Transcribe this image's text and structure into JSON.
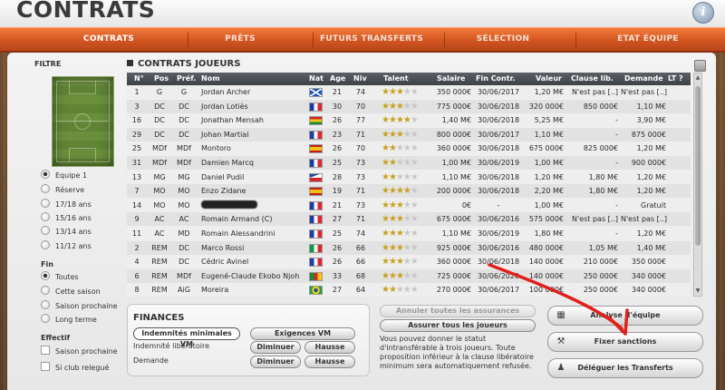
{
  "header": {
    "title": "CONTRATS",
    "info_icon": "info-icon"
  },
  "tabs": [
    {
      "label": "CONTRATS",
      "active": true
    },
    {
      "label": "PRÊTS",
      "active": false
    },
    {
      "label": "FUTURS TRANSFERTS",
      "active": false
    },
    {
      "label": "SÉLECTION",
      "active": false
    },
    {
      "label": "ETAT ÉQUIPE",
      "active": false
    }
  ],
  "filter": {
    "title": "FILTRE",
    "team_options": [
      "Equipe 1",
      "Réserve",
      "17/18 ans",
      "15/16 ans",
      "13/14 ans",
      "11/12 ans"
    ],
    "team_selected": "Equipe 1",
    "fin_title": "Fin",
    "fin_options": [
      "Toutes",
      "Cette saison",
      "Saison prochaine",
      "Long terme"
    ],
    "fin_selected": "Toutes",
    "effectif_title": "Effectif",
    "effectif_options": [
      "Saison prochaine",
      "Si club relegué"
    ]
  },
  "table": {
    "title": "CONTRATS JOUEURS",
    "columns": {
      "num": "N°",
      "pos": "Pos",
      "pref": "Préf.",
      "nom": "Nom",
      "nat": "Nat",
      "age": "Age",
      "niv": "Niv",
      "talent": "Talent",
      "salaire": "Salaire",
      "fin": "Fin Contr.",
      "valeur": "Valeur",
      "clause": "Clause lib.",
      "demande": "Demande",
      "lt": "LT ?"
    },
    "rows": [
      {
        "num": "1",
        "pos": "G",
        "pref": "G",
        "nom": "Jordan Archer",
        "nat": "scotland",
        "age": "21",
        "niv": "74",
        "stars": 3,
        "salaire": "350 000€",
        "fin": "30/06/2017",
        "valeur": "1,20 M€",
        "clause": "N'est pas [..]",
        "demande": "N'est pas [..]"
      },
      {
        "num": "3",
        "pos": "DC",
        "pref": "DC",
        "nom": "Jordan Lotiès",
        "nat": "france",
        "age": "30",
        "niv": "70",
        "stars": 3,
        "salaire": "775 000€",
        "fin": "30/06/2018",
        "valeur": "320 000€",
        "clause": "850 000€",
        "demande": "1,10 M€"
      },
      {
        "num": "16",
        "pos": "DC",
        "pref": "DC",
        "nom": "Jonathan Mensah",
        "nat": "ghana",
        "age": "26",
        "niv": "77",
        "stars": 4,
        "salaire": "1,40 M€",
        "fin": "30/06/2018",
        "valeur": "5,25 M€",
        "clause": "-",
        "demande": "3,90 M€"
      },
      {
        "num": "29",
        "pos": "DC",
        "pref": "DC",
        "nom": "Johan Martial",
        "nat": "france",
        "age": "23",
        "niv": "71",
        "stars": 3,
        "salaire": "800 000€",
        "fin": "30/06/2017",
        "valeur": "1,10 M€",
        "clause": "-",
        "demande": "875 000€"
      },
      {
        "num": "25",
        "pos": "MDf",
        "pref": "MDf",
        "nom": "Montoro",
        "nat": "spain",
        "age": "26",
        "niv": "70",
        "stars": 2,
        "salaire": "360 000€",
        "fin": "30/06/2018",
        "valeur": "675 000€",
        "clause": "825 000€",
        "demande": "1,20 M€"
      },
      {
        "num": "31",
        "pos": "MDf",
        "pref": "MDf",
        "nom": "Damien Marcq",
        "nat": "france",
        "age": "25",
        "niv": "73",
        "stars": 2,
        "salaire": "1,00 M€",
        "fin": "30/06/2019",
        "valeur": "1,00 M€",
        "clause": "-",
        "demande": "900 000€"
      },
      {
        "num": "13",
        "pos": "MG",
        "pref": "MG",
        "nom": "Daniel Pudil",
        "nat": "czech",
        "age": "28",
        "niv": "73",
        "stars": 2,
        "salaire": "1,10 M€",
        "fin": "30/06/2018",
        "valeur": "1,20 M€",
        "clause": "1,80 M€",
        "demande": "1,20 M€"
      },
      {
        "num": "7",
        "pos": "MO",
        "pref": "MO",
        "nom": "Enzo Zidane",
        "nat": "spain",
        "age": "19",
        "niv": "71",
        "stars": 4,
        "salaire": "200 000€",
        "fin": "30/06/2018",
        "valeur": "2,20 M€",
        "clause": "1,80 M€",
        "demande": "1,20 M€"
      },
      {
        "num": "14",
        "pos": "MO",
        "pref": "MO",
        "nom": "",
        "hidden": true,
        "nat": "france",
        "age": "21",
        "niv": "73",
        "stars": 3,
        "salaire": "0€",
        "fin": "-",
        "valeur": "1,00 M€",
        "clause": "-",
        "demande": "Gratuit"
      },
      {
        "num": "9",
        "pos": "AC",
        "pref": "AC",
        "nom": "Romain Armand (C)",
        "nat": "france",
        "age": "27",
        "niv": "71",
        "stars": 3,
        "salaire": "675 000€",
        "fin": "30/06/2016",
        "valeur": "575 000€",
        "clause": "N'est pas [..]",
        "demande": "N'est pas [..]"
      },
      {
        "num": "11",
        "pos": "AC",
        "pref": "MD",
        "nom": "Romain Alessandrini",
        "nat": "france",
        "age": "25",
        "niv": "74",
        "stars": 3,
        "salaire": "1,10 M€",
        "fin": "30/06/2019",
        "valeur": "1,80 M€",
        "clause": "-",
        "demande": "1,20 M€"
      },
      {
        "num": "2",
        "pos": "REM",
        "pref": "DC",
        "nom": "Marco Rossi",
        "nat": "italy",
        "age": "26",
        "niv": "66",
        "stars": 3,
        "salaire": "925 000€",
        "fin": "30/06/2016",
        "valeur": "480 000€",
        "clause": "1,05 M€",
        "demande": "1,40 M€"
      },
      {
        "num": "4",
        "pos": "REM",
        "pref": "DC",
        "nom": "Cédric Avinel",
        "nat": "france",
        "age": "26",
        "niv": "66",
        "stars": 3,
        "salaire": "360 000€",
        "fin": "30/06/2018",
        "valeur": "140 000€",
        "clause": "210 000€",
        "demande": "350 000€"
      },
      {
        "num": "6",
        "pos": "REM",
        "pref": "MDf",
        "nom": "Eugené-Claude Ekobo Njoh",
        "nat": "cameroon",
        "age": "33",
        "niv": "68",
        "stars": 3,
        "salaire": "725 000€",
        "fin": "30/06/2020",
        "valeur": "140 000€",
        "clause": "250 000€",
        "demande": "340 000€"
      },
      {
        "num": "8",
        "pos": "REM",
        "pref": "AiG",
        "nom": "Moreira",
        "nat": "brazil",
        "age": "27",
        "niv": "64",
        "stars": 2,
        "salaire": "270 000€",
        "fin": "30/06/2017",
        "valeur": "100 000€",
        "clause": "250 000€",
        "demande": "340 000€"
      }
    ]
  },
  "finances": {
    "title": "FINANCES",
    "indemnites_label": "Indemnités minimales VM",
    "exigences_label": "Exigences VM",
    "indemnite_lib_label": "Indemnité libératoire",
    "demande_label": "Demande",
    "diminuer": "Diminuer",
    "hausse": "Hausse"
  },
  "assurances": {
    "annuler_label": "Annuler toutes les assurances",
    "assurer_label": "Assurer tous les joueurs",
    "note": "Vous pouvez donner le statut d'intransférable à trois joueurs. Toute proposition inférieur à la clause libératoire minimum sera automatiquement refusée."
  },
  "actions": {
    "analyse_label": "Analyse d'équipe",
    "sanctions_label": "Fixer sanctions",
    "deleguer_label": "Déléguer les Transferts"
  },
  "colors": {
    "accent": "#d65a22",
    "arrow": "#e0201a",
    "star": "#c9a020"
  }
}
